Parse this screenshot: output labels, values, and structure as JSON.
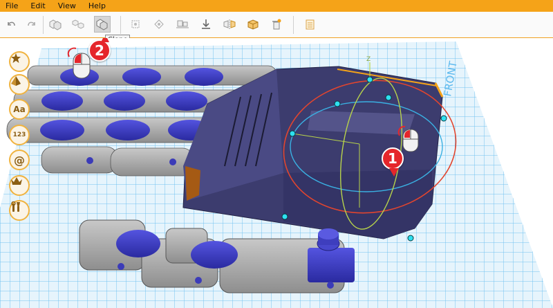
{
  "menu": [
    "File",
    "Edit",
    "View",
    "Help"
  ],
  "toolbar": {
    "buttons": [
      {
        "name": "undo-button",
        "icon": "undo-icon"
      },
      {
        "name": "redo-button",
        "icon": "redo-icon"
      },
      {
        "name": "group-button",
        "icon": "group-icon"
      },
      {
        "name": "ungroup-button",
        "icon": "ungroup-icon"
      },
      {
        "name": "clone-button",
        "icon": "clone-icon",
        "active": true
      },
      {
        "name": "align-button",
        "icon": "align-icon"
      },
      {
        "name": "distribute-button",
        "icon": "distribute-icon"
      },
      {
        "name": "lay-flat-button",
        "icon": "lay-flat-icon"
      },
      {
        "name": "drop-to-floor-button",
        "icon": "drop-to-floor-icon"
      },
      {
        "name": "mirror-button",
        "icon": "mirror-icon"
      },
      {
        "name": "solid-button",
        "icon": "solid-icon"
      },
      {
        "name": "delete-button",
        "icon": "trash-icon"
      },
      {
        "name": "notes-button",
        "icon": "notes-icon"
      }
    ],
    "tooltip": "Clone"
  },
  "sidebar": [
    {
      "name": "favorites-button",
      "icon": "star-icon"
    },
    {
      "name": "shapes-button",
      "icon": "pyramid-icon"
    },
    {
      "name": "text-button",
      "label": "Aa"
    },
    {
      "name": "numbers-button",
      "label": "123"
    },
    {
      "name": "symbols-button",
      "label": "@"
    },
    {
      "name": "premium-button",
      "icon": "crown-icon"
    },
    {
      "name": "tools-button",
      "icon": "tools-icon"
    }
  ],
  "viewport": {
    "axis_label": "Z",
    "grid_label": "FRONT",
    "callouts": [
      "1",
      "2"
    ]
  },
  "colors": {
    "accent": "#f5a318",
    "grid": "#4fb3ea",
    "part_blue": "#3c3cc2",
    "part_gray": "#a9a9a9",
    "selected_body": "#43437a",
    "gizmo_red": "#e2452e",
    "gizmo_cyan": "#3ab0e2",
    "gizmo_green": "#b8d44a",
    "callout": "#e5262b"
  }
}
